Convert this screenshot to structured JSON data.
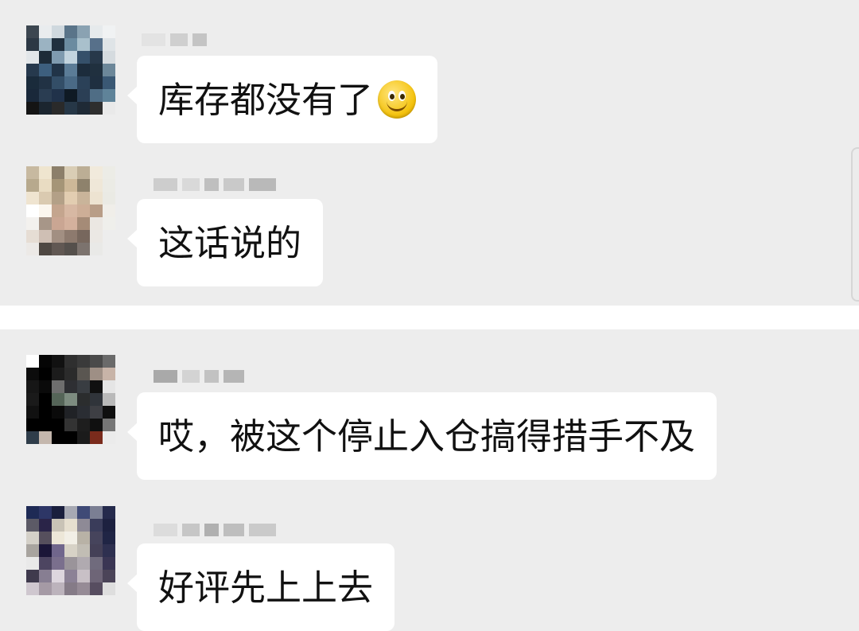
{
  "messages": [
    {
      "text": "库存都没有了",
      "emoji": "smile-emoji"
    },
    {
      "text": "这话说的"
    },
    {
      "text": "哎，被这个停止入仓搞得措手不及"
    },
    {
      "text": "好评先上上去"
    }
  ],
  "avatars": [
    {
      "colors": [
        "#3c4650",
        "#e9ecee",
        "#cfd8de",
        "#5a7489",
        "#8aa2b2",
        "#e6eaec",
        "#f0f2f3",
        "#2c3844",
        "#9bb3c2",
        "#20303f",
        "#6b8ba0",
        "#a9c0cc",
        "#57708a",
        "#dfe4e7",
        "#e2e6e9",
        "#1d2b38",
        "#7f9bb0",
        "#c2d4df",
        "#35506a",
        "#27384a",
        "#d5dbdf",
        "#26394d",
        "#3d5f7e",
        "#213448",
        "#5b7c97",
        "#1c2c3c",
        "#20303f",
        "#6c8799",
        "#1a2b3b",
        "#213244",
        "#334e67",
        "#4a6a86",
        "#2b4158",
        "#1f2f40",
        "#3a5874",
        "#19283a",
        "#2a3d52",
        "#20324a",
        "#0f1a24",
        "#2b3f55",
        "#4f6d85",
        "#5f8399",
        "#141414",
        "#1b252f",
        "#2a2a2a",
        "#263747",
        "#1f2a36",
        "#2e2e2e",
        "#e9e9e9"
      ]
    },
    {
      "colors": [
        "#c7b9a0",
        "#efe5cf",
        "#8c7f6a",
        "#d9cdb5",
        "#bcae95",
        "#f1eadc",
        "#ecece6",
        "#b7a98d",
        "#e9dcc2",
        "#a59577",
        "#cdb898",
        "#8e826c",
        "#efe7d8",
        "#ebebe5",
        "#efe4d0",
        "#dacab0",
        "#b3a087",
        "#e2cdb1",
        "#c9b49a",
        "#ede3d1",
        "#eaeae4",
        "#ffffff",
        "#fbf6ee",
        "#c4a58e",
        "#d7b8a3",
        "#cdae97",
        "#b89d87",
        "#f0eee9",
        "#f3f1ee",
        "#a79688",
        "#caa693",
        "#d4b19d",
        "#a58b77",
        "#ebe7e2",
        "#efefeb",
        "#e6ddd4",
        "#cfbfb4",
        "#a28f82",
        "#8d7a6e",
        "#77675d",
        "#ebe8e4",
        "#ededed",
        "#ece9e6",
        "#4f4843",
        "#615853",
        "#55504c",
        "#7c736e",
        "#e9e9e7",
        "#ededed"
      ]
    },
    {
      "colors": [
        "#ffffff",
        "#050505",
        "#111111",
        "#2f2f2f",
        "#3a3a3a",
        "#4a4a4a",
        "#6a6a6a",
        "#0c0c0c",
        "#000000",
        "#1c1c1c",
        "#2b2b2b",
        "#5a5651",
        "#9e8f85",
        "#c8b4a8",
        "#161616",
        "#0a0a0a",
        "#6e6e6e",
        "#2e2f33",
        "#393d42",
        "#101010",
        "#e5e5e5",
        "#1a1a1a",
        "#000000",
        "#556558",
        "#7d8c80",
        "#2b2d2e",
        "#30343a",
        "#b9b9b9",
        "#111111",
        "#000000",
        "#0a0a0a",
        "#202226",
        "#2a2d33",
        "#3e3f44",
        "#0f0f0f",
        "#000000",
        "#000000",
        "#000000",
        "#333333",
        "#1e1e1e",
        "#101010",
        "#767676",
        "#2f3d4a",
        "#c4b7ad",
        "#000000",
        "#000000",
        "#1b1b1b",
        "#7a2b1c",
        "#ebebeb"
      ]
    },
    {
      "colors": [
        "#1e2a55",
        "#2d3666",
        "#1a1f3d",
        "#a7a9b3",
        "#3f4a76",
        "#7b7f93",
        "#252a4c",
        "#5c5a66",
        "#2a2448",
        "#c9c3b6",
        "#e6dfcf",
        "#8e8a96",
        "#3a3c5a",
        "#1d2140",
        "#d4d0c8",
        "#564f5d",
        "#ede7d8",
        "#f2efe6",
        "#b8b2a6",
        "#46445c",
        "#202545",
        "#a8a49f",
        "#1b1638",
        "#70668c",
        "#d7d2c6",
        "#c1bdb4",
        "#444057",
        "#2e3050",
        "#e9e9e9",
        "#4d4561",
        "#7a6f8d",
        "#9a949a",
        "#b0aab0",
        "#706b7d",
        "#3a3654",
        "#3f3a4d",
        "#877e92",
        "#ddd6de",
        "#8c8296",
        "#c8c0c6",
        "#6e6577",
        "#4b4458",
        "#cfc7cf",
        "#a59aa5",
        "#bcb3bc",
        "#857b87",
        "#968b96",
        "#574d60",
        "#dedede"
      ]
    }
  ],
  "names": [
    {
      "colors": [
        "#e3e3e3",
        "#cfcfcf",
        "#c4c4c4"
      ]
    },
    {
      "colors": [
        "#cdcdcd",
        "#d9d9d9",
        "#bfbfbf",
        "#c9c9c9",
        "#b9b9b9"
      ]
    },
    {
      "colors": [
        "#a9a9a9",
        "#d3d3d3",
        "#c2c2c2",
        "#b5b5b5"
      ]
    },
    {
      "colors": [
        "#dcdcdc",
        "#c6c6c6",
        "#b0b0b0",
        "#bebebe",
        "#cacaca"
      ]
    }
  ]
}
